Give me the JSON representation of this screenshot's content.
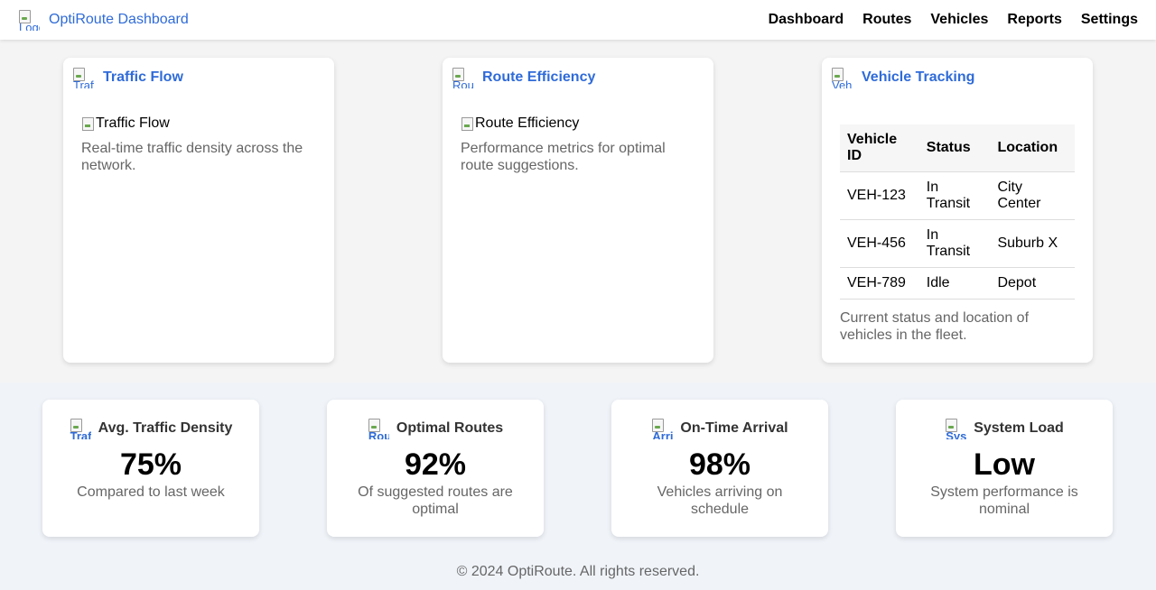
{
  "header": {
    "logo_alt": "Logo",
    "title": "OptiRoute Dashboard",
    "nav": [
      "Dashboard",
      "Routes",
      "Vehicles",
      "Reports",
      "Settings"
    ]
  },
  "cards": [
    {
      "icon_alt": "Traffic",
      "title": "Traffic Flow",
      "image_alt": "Traffic Flow",
      "description": "Real-time traffic density across the network."
    },
    {
      "icon_alt": "Route",
      "title": "Route Efficiency",
      "image_alt": "Route Efficiency",
      "description": "Performance metrics for optimal route suggestions."
    },
    {
      "icon_alt": "Vehicle",
      "title": "Vehicle Tracking",
      "table": {
        "headers": [
          "Vehicle ID",
          "Status",
          "Location"
        ],
        "rows": [
          [
            "VEH-123",
            "In Transit",
            "City Center"
          ],
          [
            "VEH-456",
            "In Transit",
            "Suburb X"
          ],
          [
            "VEH-789",
            "Idle",
            "Depot"
          ]
        ]
      },
      "description": "Current status and location of vehicles in the fleet."
    }
  ],
  "metrics": [
    {
      "icon_alt": "Traffic",
      "label": "Avg. Traffic Density",
      "value": "75%",
      "description": "Compared to last week"
    },
    {
      "icon_alt": "Routes",
      "label": "Optimal Routes",
      "value": "92%",
      "description": "Of suggested routes are optimal"
    },
    {
      "icon_alt": "Arrival",
      "label": "On-Time Arrival",
      "value": "98%",
      "description": "Vehicles arriving on schedule"
    },
    {
      "icon_alt": "System",
      "label": "System Load",
      "value": "Low",
      "description": "System performance is nominal"
    }
  ],
  "footer": {
    "text": "© 2024 OptiRoute. All rights reserved."
  },
  "colors": {
    "accent": "#2f6bd8",
    "muted_text": "#666666",
    "metric_band": "#f0f4f9"
  }
}
